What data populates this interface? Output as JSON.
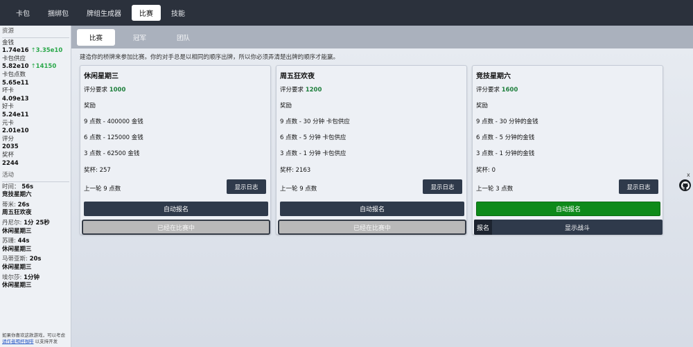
{
  "nav": {
    "tabs": [
      {
        "label": "卡包"
      },
      {
        "label": "捆绑包"
      },
      {
        "label": "牌组生成器"
      },
      {
        "label": "比赛"
      },
      {
        "label": "技能"
      }
    ],
    "active": "比赛"
  },
  "sidebar": {
    "resources_title": "资源",
    "resources": [
      {
        "label": "金钱",
        "value": "1.74e16",
        "delta": "3.35e10"
      },
      {
        "label": "卡包供应",
        "value": "5.82e10",
        "delta": "14150"
      },
      {
        "label": "卡包点数",
        "value": "5.65e11"
      },
      {
        "label": "坏卡",
        "value": "4.09e13"
      },
      {
        "label": "好卡",
        "value": "5.24e11"
      },
      {
        "label": "元卡",
        "value": "2.01e10"
      },
      {
        "label": "评分",
        "value": "2035"
      },
      {
        "label": "奖杯",
        "value": "2244"
      }
    ],
    "activity_title": "活动",
    "activity": [
      {
        "name": "时间：",
        "value": "56s",
        "event": "竞技星期六"
      },
      {
        "name": "蒂米:",
        "value": "26s",
        "event": "周五狂欢夜"
      },
      {
        "name": "丹尼尔:",
        "value": "1分 25秒",
        "event": "休闲星期三"
      },
      {
        "name": "苏珊:",
        "value": "44s",
        "event": "休闲星期三"
      },
      {
        "name": "马蒂亚斯:",
        "value": "20s",
        "event": "休闲星期三"
      },
      {
        "name": "埃尔莎:",
        "value": "1分钟",
        "event": "休闲星期三"
      }
    ],
    "footer_line1": "如果你喜欢这款游戏，可以考虑",
    "footer_link": "请作者喝杯咖啡",
    "footer_line2": "以支持开发"
  },
  "subnav": {
    "tabs": [
      {
        "label": "比赛"
      },
      {
        "label": "冠军"
      },
      {
        "label": "团队"
      }
    ]
  },
  "intro": "建造你的桥牌来参加比赛。你的对手总是以相同的顺序出牌，所以你必须弄清楚出牌的顺序才能赢。",
  "tournaments": [
    {
      "title": "休闲星期三",
      "rating_label": "评分要求",
      "rating_value": "1000",
      "rewards_label": "奖励",
      "rewards": [
        "9 点数 - 400000 金钱",
        "6 点数 - 125000 金钱",
        "3 点数 - 62500 金钱"
      ],
      "trophies": "奖杯: 257",
      "last_round": "上一轮  9 点数",
      "log_button": "显示日志",
      "auto_button": "自动报名",
      "status_button": "已经在比赛中"
    },
    {
      "title": "周五狂欢夜",
      "rating_label": "评分要求",
      "rating_value": "1200",
      "rewards_label": "奖励",
      "rewards": [
        "9 点数 - 30 分钟 卡包供应",
        "6 点数 - 5 分钟 卡包供应",
        "3 点数 - 1 分钟 卡包供应"
      ],
      "trophies": "奖杯: 2163",
      "last_round": "上一轮  9 点数",
      "log_button": "显示日志",
      "auto_button": "自动报名",
      "status_button": "已经在比赛中"
    },
    {
      "title": "竞技星期六",
      "rating_label": "评分要求",
      "rating_value": "1600",
      "rewards_label": "奖励",
      "rewards": [
        "9 点数 - 30 分钟的金钱",
        "6 点数 - 5 分钟的金钱",
        "3 点数 - 1 分钟的金钱"
      ],
      "trophies": "奖杯: 0",
      "last_round": "上一轮  3 点数",
      "log_button": "显示日志",
      "auto_button": "自动报名",
      "register_button": "报名",
      "show_battle_button": "显示战斗"
    }
  ],
  "corner": {
    "close": "x",
    "icon": "github-icon"
  }
}
